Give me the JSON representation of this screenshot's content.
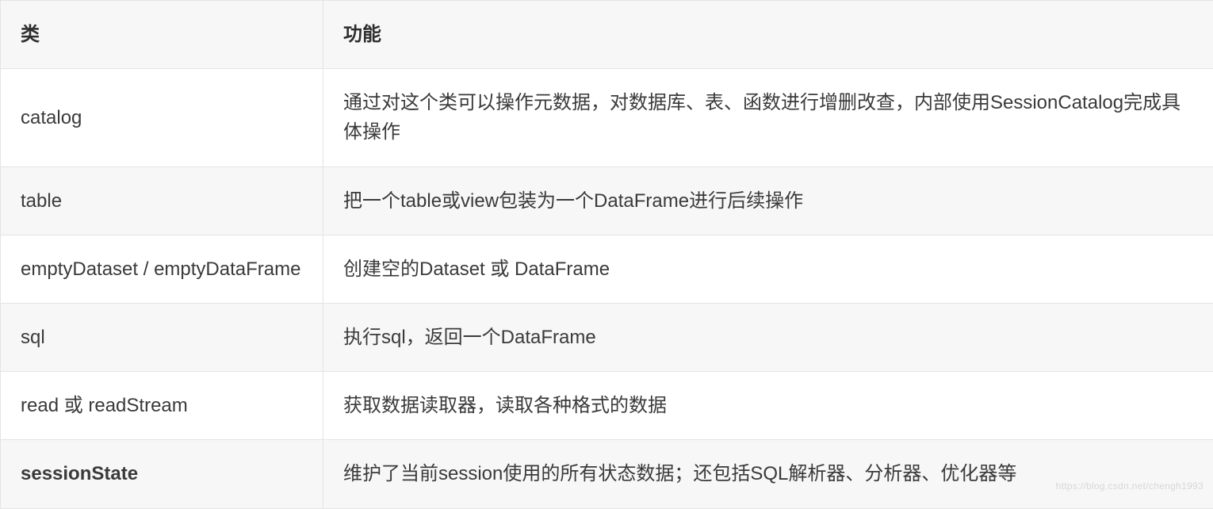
{
  "table": {
    "headers": [
      "类",
      "功能"
    ],
    "rows": [
      {
        "class": "catalog",
        "desc": "通过对这个类可以操作元数据，对数据库、表、函数进行增删改查，内部使用SessionCatalog完成具体操作"
      },
      {
        "class": "table",
        "desc": "把一个table或view包装为一个DataFrame进行后续操作"
      },
      {
        "class": "emptyDataset / emptyDataFrame",
        "desc": "创建空的Dataset 或 DataFrame"
      },
      {
        "class": "sql",
        "desc": "执行sql，返回一个DataFrame"
      },
      {
        "class": "read 或 readStream",
        "desc": "获取数据读取器，读取各种格式的数据"
      },
      {
        "class": "sessionState",
        "desc": "维护了当前session使用的所有状态数据；还包括SQL解析器、分析器、优化器等"
      }
    ]
  },
  "watermark": "https://blog.csdn.net/chengh1993"
}
